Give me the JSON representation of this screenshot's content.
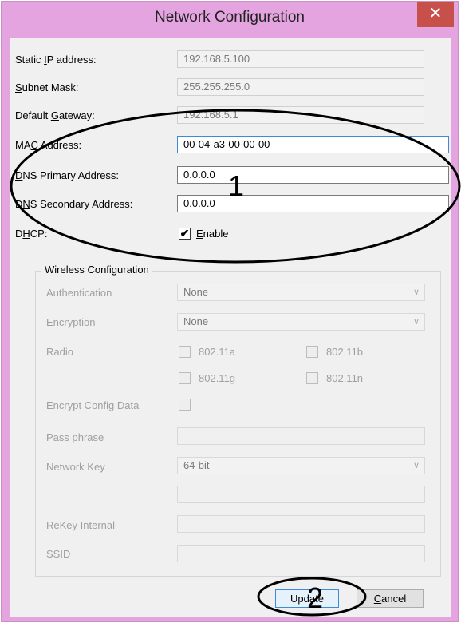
{
  "window": {
    "title": "Network Configuration",
    "close_glyph": "✕"
  },
  "network": {
    "static_ip": {
      "label_pre": "Static ",
      "label_ul": "I",
      "label_post": "P address:",
      "value": "192.168.5.100"
    },
    "subnet": {
      "label_pre": "",
      "label_ul": "S",
      "label_post": "ubnet Mask:",
      "value": "255.255.255.0"
    },
    "gateway": {
      "label_pre": "Default ",
      "label_ul": "G",
      "label_post": "ateway:",
      "value": "192.168.5.1"
    },
    "mac": {
      "label_pre": "MA",
      "label_ul": "C",
      "label_post": " Address:",
      "value": "00-04-a3-00-00-00"
    },
    "dns_primary": {
      "label_pre": "",
      "label_ul": "D",
      "label_post": "NS Primary Address:",
      "value": "0.0.0.0"
    },
    "dns_secondary": {
      "label_pre": "D",
      "label_ul": "N",
      "label_post": "S Secondary Address:",
      "value": "0.0.0.0"
    },
    "dhcp": {
      "label_pre": "D",
      "label_ul": "H",
      "label_post": "CP:",
      "check_ul": "E",
      "check_post": "nable",
      "checked": true
    }
  },
  "wireless": {
    "group_title": "Wireless Configuration",
    "authentication": {
      "label": "Authentication",
      "value": "None"
    },
    "encryption": {
      "label": "Encryption",
      "value": "None"
    },
    "radio": {
      "label": "Radio",
      "options": [
        "802.11a",
        "802.11b",
        "802.11g",
        "802.11n"
      ]
    },
    "encrypt_config": {
      "label": "Encrypt Config Data"
    },
    "pass_phrase": {
      "label": "Pass phrase",
      "value": ""
    },
    "network_key": {
      "label": "Network Key",
      "value": "64-bit",
      "key_value": ""
    },
    "rekey": {
      "label": "ReKey Internal",
      "value": ""
    },
    "ssid": {
      "label": "SSID",
      "value": ""
    }
  },
  "buttons": {
    "update": "Update",
    "cancel_ul": "C",
    "cancel_post": "ancel"
  },
  "annotations": {
    "marker_1": "1",
    "marker_2": "2"
  },
  "icons": {
    "dropdown": "chevron-down-icon",
    "check": "✔"
  }
}
